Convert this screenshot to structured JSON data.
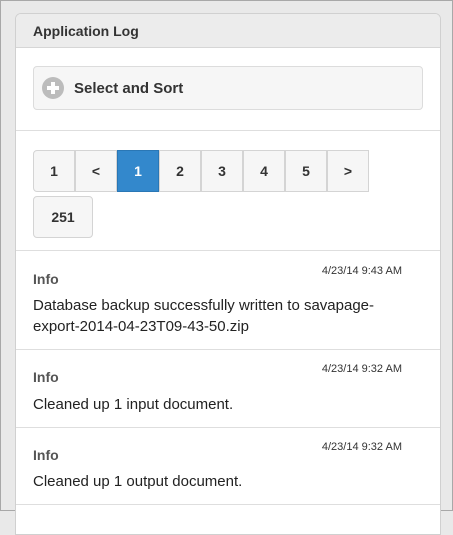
{
  "panel": {
    "title": "Application Log"
  },
  "filter": {
    "label": "Select and Sort",
    "icon": "plus-circle-icon"
  },
  "pagination": {
    "first": "1",
    "prev": "<",
    "pages": [
      "1",
      "2",
      "3",
      "4",
      "5"
    ],
    "current": "1",
    "next": ">",
    "last": "251"
  },
  "entries": [
    {
      "level": "Info",
      "time": "4/23/14 9:43 AM",
      "message": "Database backup successfully written to savapage-export-2014-04-23T09-43-50.zip"
    },
    {
      "level": "Info",
      "time": "4/23/14 9:32 AM",
      "message": "Cleaned up 1 input document."
    },
    {
      "level": "Info",
      "time": "4/23/14 9:32 AM",
      "message": "Cleaned up 1 output document."
    }
  ],
  "colors": {
    "accent": "#3388cc",
    "header_bg": "#ececec",
    "page_bg": "#e9e9e9"
  }
}
